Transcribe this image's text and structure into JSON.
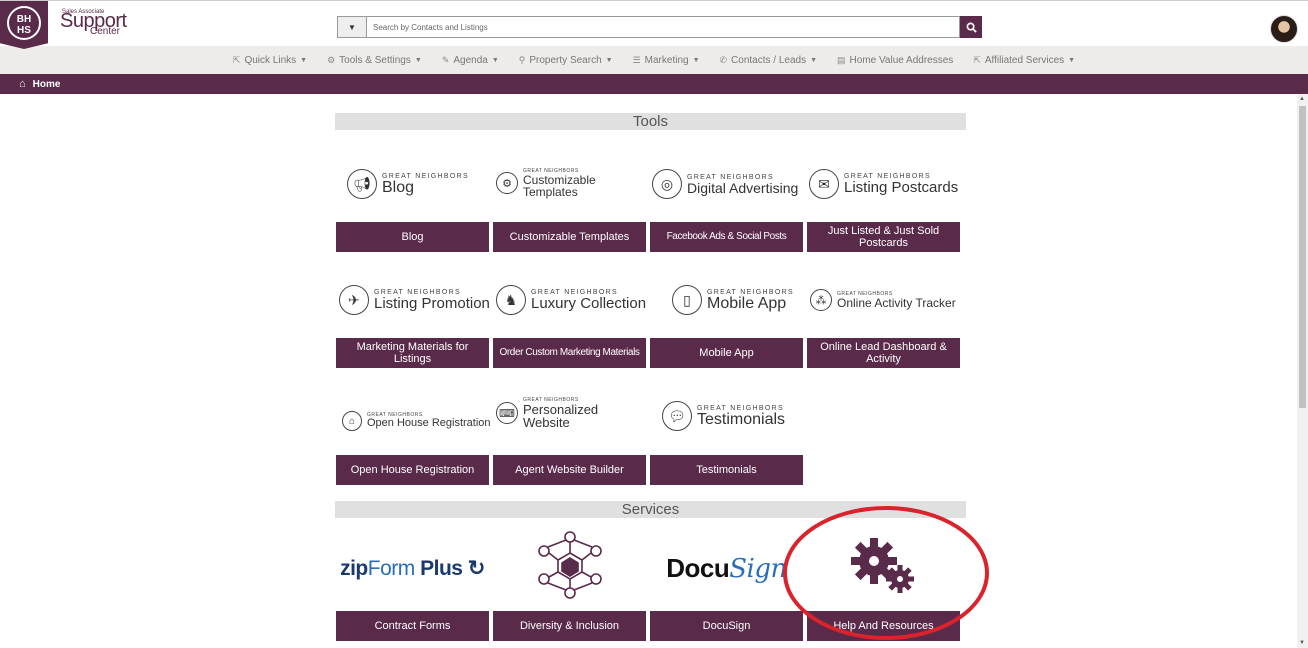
{
  "header": {
    "logo_badge": "BH HS",
    "logo_small": "Sales Associate",
    "logo_big": "Support",
    "logo_sub": "Center",
    "search_placeholder": "Search by Contacts and Listings"
  },
  "nav": [
    {
      "label": "Quick Links",
      "icon": "external-link-icon",
      "caret": true
    },
    {
      "label": "Tools & Settings",
      "icon": "cogs-icon",
      "caret": true
    },
    {
      "label": "Agenda",
      "icon": "edit-icon",
      "caret": true
    },
    {
      "label": "Property Search",
      "icon": "search-icon",
      "caret": true
    },
    {
      "label": "Marketing",
      "icon": "list-icon",
      "caret": true
    },
    {
      "label": "Contacts / Leads",
      "icon": "phone-icon",
      "caret": true
    },
    {
      "label": "Home Value Addresses",
      "icon": "document-icon",
      "caret": false
    },
    {
      "label": "Affiliated Services",
      "icon": "external-link-icon",
      "caret": true
    }
  ],
  "breadcrumb": {
    "label": "Home"
  },
  "sections": {
    "tools": "Tools",
    "services": "Services"
  },
  "tools": [
    {
      "brand_gn": "GREAT NEIGHBORS",
      "brand_title": "Blog",
      "button": "Blog"
    },
    {
      "brand_gn": "GREAT NEIGHBORS",
      "brand_title": "Customizable Templates",
      "button": "Customizable Templates"
    },
    {
      "brand_gn": "GREAT NEIGHBORS",
      "brand_title": "Digital Advertising",
      "button": "Facebook Ads & Social Posts"
    },
    {
      "brand_gn": "GREAT NEIGHBORS",
      "brand_title": "Listing Postcards",
      "button": "Just Listed & Just Sold Postcards"
    },
    {
      "brand_gn": "GREAT NEIGHBORS",
      "brand_title": "Listing Promotion",
      "button": "Marketing Materials for Listings"
    },
    {
      "brand_gn": "GREAT NEIGHBORS",
      "brand_title": "Luxury Collection",
      "button": "Order Custom Marketing Materials"
    },
    {
      "brand_gn": "GREAT NEIGHBORS",
      "brand_title": "Mobile App",
      "button": "Mobile App"
    },
    {
      "brand_gn": "GREAT NEIGHBORS",
      "brand_title": "Online Activity Tracker",
      "button": "Online Lead Dashboard & Activity"
    },
    {
      "brand_gn": "GREAT NEIGHBORS",
      "brand_title": "Open House Registration",
      "button": "Open House Registration"
    },
    {
      "brand_gn": "GREAT NEIGHBORS",
      "brand_title": "Personalized Website",
      "button": "Agent Website Builder"
    },
    {
      "brand_gn": "GREAT NEIGHBORS",
      "brand_title": "Testimonials",
      "button": "Testimonials"
    }
  ],
  "services": [
    {
      "logo": "zipForm Plus",
      "logo_a": "zip",
      "logo_b": "Form",
      "logo_c": " Plus",
      "button": "Contract Forms"
    },
    {
      "logo": "diversity-network-icon",
      "button": "Diversity & Inclusion"
    },
    {
      "logo_a": "Docu",
      "logo_b": "Sign",
      "button": "DocuSign"
    },
    {
      "logo": "gears-icon",
      "button": "Help And Resources"
    }
  ],
  "colors": {
    "brand_purple": "#5a2a4b",
    "highlight_red": "#d9232d"
  }
}
